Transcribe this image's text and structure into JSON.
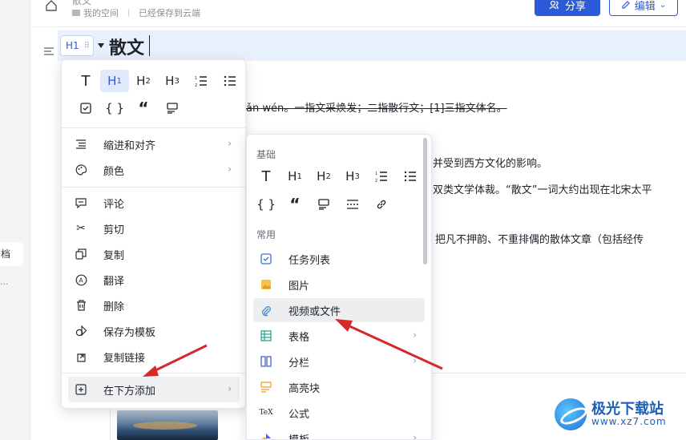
{
  "topbar": {
    "doc_title": "散文",
    "crumb_space": "我的空间",
    "crumb_status": "已经保存到云端",
    "share_label": "分享",
    "edit_label": "编辑"
  },
  "sidebar": {
    "item_label": "档",
    "dots": "..."
  },
  "editor": {
    "heading_badge": "H1",
    "heading_text": "散文",
    "para1": "ǎn wén。一指文采焕发；二指散行文；[1]三指文体名。",
    "para2": "并受到西方文化的影响。",
    "para3": "双类文学体裁。“散文”一词大约出现在北宋太平",
    "para4": "把凡不押韵、不重排偶的散体文章（包括经传"
  },
  "block_menu": {
    "format_icons": [
      "T",
      "H1",
      "H2",
      "H3",
      "ordered-list-icon",
      "bullet-list-icon",
      "checkbox-icon",
      "{}",
      "quote-icon",
      "callout-icon"
    ],
    "items": [
      {
        "label": "缩进和对齐",
        "icon": "align-icon",
        "submenu": true
      },
      {
        "label": "颜色",
        "icon": "palette-icon",
        "submenu": true
      },
      {
        "label": "评论",
        "icon": "comment-icon",
        "submenu": false
      },
      {
        "label": "剪切",
        "icon": "scissors-icon",
        "submenu": false
      },
      {
        "label": "复制",
        "icon": "copy-icon",
        "submenu": false
      },
      {
        "label": "翻译",
        "icon": "translate-icon",
        "submenu": false
      },
      {
        "label": "删除",
        "icon": "trash-icon",
        "submenu": false
      },
      {
        "label": "保存为模板",
        "icon": "template-icon",
        "submenu": false
      },
      {
        "label": "复制链接",
        "icon": "link-icon",
        "submenu": false
      },
      {
        "label": "在下方添加",
        "icon": "plus-square-icon",
        "submenu": true
      }
    ]
  },
  "insert_menu": {
    "section_basic": "基础",
    "section_common": "常用",
    "basic_icons": [
      "T",
      "H1",
      "H2",
      "H3",
      "ordered-list-icon",
      "bullet-list-icon",
      "{}",
      "quote-icon",
      "callout-icon",
      "divider-icon",
      "link-icon"
    ],
    "items": [
      {
        "label": "任务列表",
        "icon": "task-icon",
        "submenu": false
      },
      {
        "label": "图片",
        "icon": "image-icon",
        "submenu": false
      },
      {
        "label": "视频或文件",
        "icon": "paperclip-icon",
        "submenu": false
      },
      {
        "label": "表格",
        "icon": "table-icon",
        "submenu": true
      },
      {
        "label": "分栏",
        "icon": "columns-icon",
        "submenu": true
      },
      {
        "label": "高亮块",
        "icon": "highlight-icon",
        "submenu": false
      },
      {
        "label": "公式",
        "icon": "tex-icon",
        "submenu": false
      },
      {
        "label": "模板",
        "icon": "template-icon",
        "submenu": true
      }
    ]
  },
  "watermark": {
    "title": "极光下载站",
    "url": "www.xz7.com"
  },
  "colors": {
    "accent": "#2b5bd7",
    "annotation_arrow": "#d42a2a"
  }
}
